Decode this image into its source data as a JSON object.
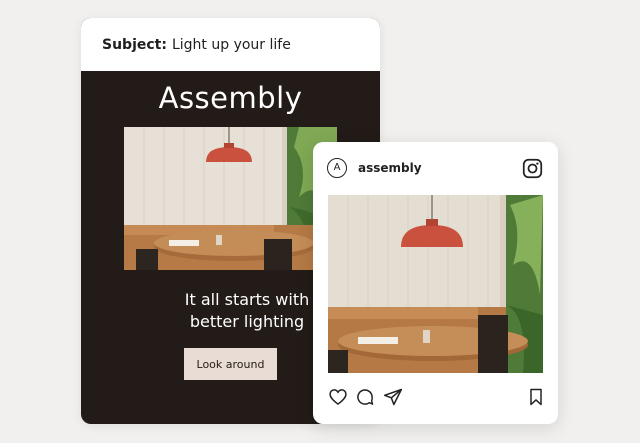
{
  "email": {
    "subject_label": "Subject:",
    "subject_text": "Light up your life",
    "brand": "Assembly",
    "tagline_line1": "It all starts with",
    "tagline_line2": "better lighting",
    "cta_label": "Look around"
  },
  "instagram": {
    "avatar_letter": "A",
    "handle": "assembly",
    "actions": [
      "heart-icon",
      "comment-icon",
      "share-icon",
      "bookmark-icon"
    ]
  },
  "colors": {
    "background": "#f1f0ee",
    "email_dark": "#221b18",
    "cta_bg": "#e9dcd4",
    "lamp": "#c9513d"
  }
}
